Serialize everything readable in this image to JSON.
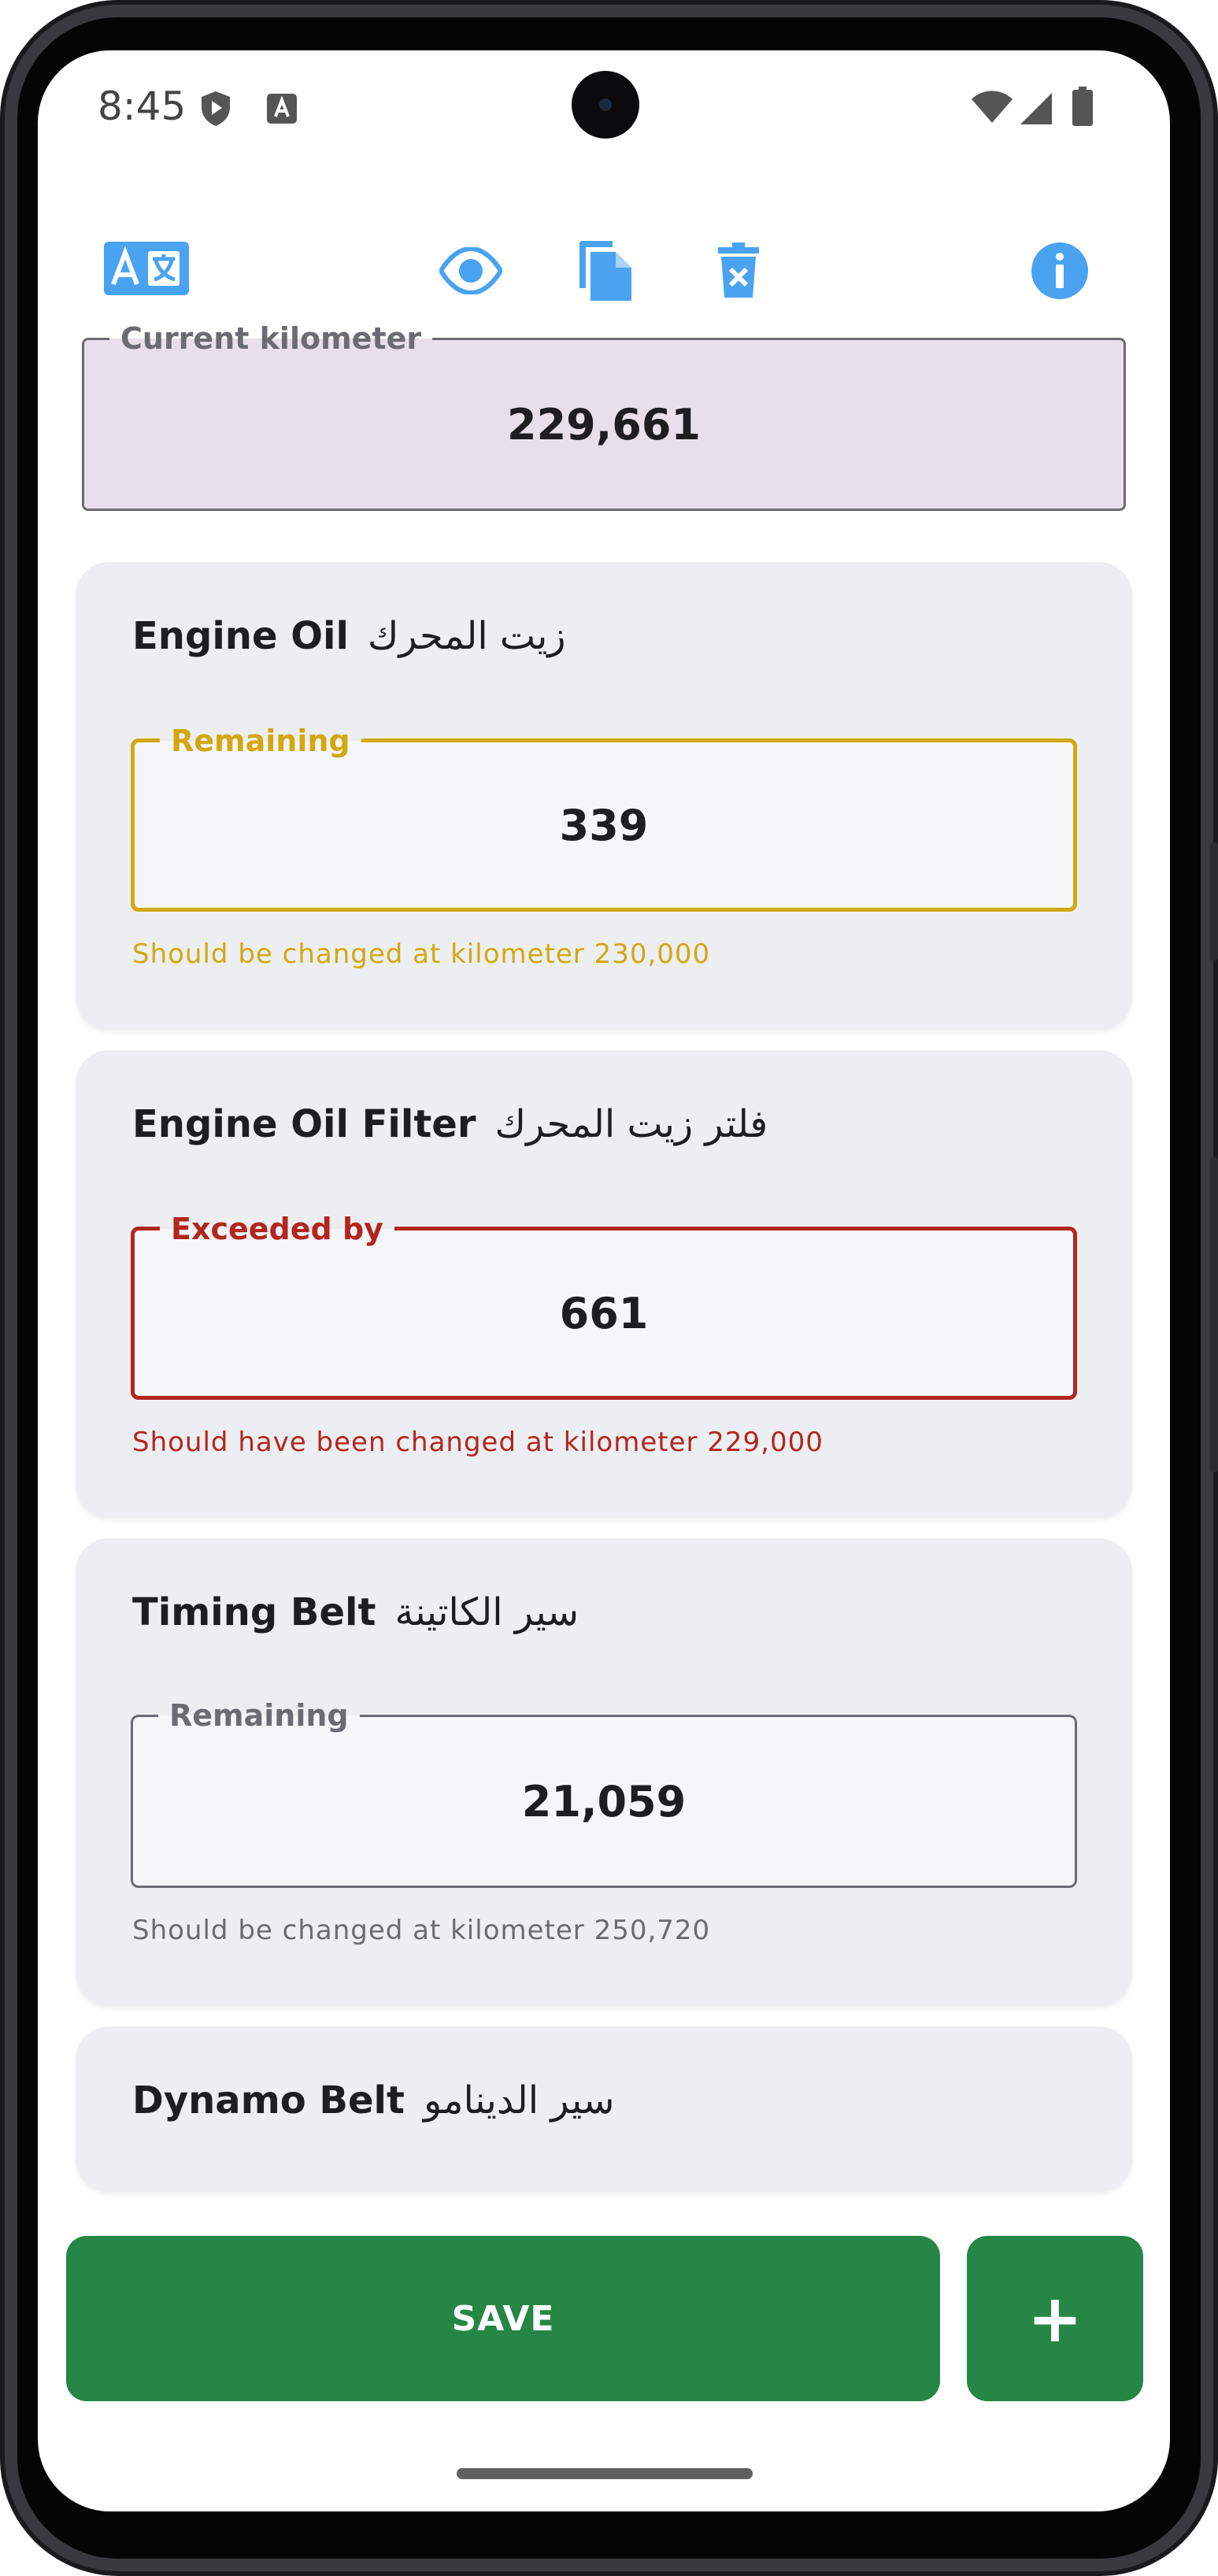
{
  "status_bar": {
    "time": "8:45"
  },
  "toolbar": {
    "icons": [
      "translate-icon",
      "eye-icon",
      "copy-icon",
      "delete-icon",
      "info-icon"
    ],
    "accent": "#4aa3f0"
  },
  "current_km": {
    "label": "Current kilometer",
    "value": "229,661"
  },
  "items": [
    {
      "title": "Engine Oil",
      "title_ar": "زيت المحرك",
      "field_label": "Remaining",
      "value": "339",
      "hint": "Should be changed at kilometer 230,000",
      "color": "#d2a80e"
    },
    {
      "title": "Engine Oil Filter",
      "title_ar": "فلتر زيت المحرك",
      "field_label": "Exceeded by",
      "value": "661",
      "hint": "Should have been changed at kilometer 229,000",
      "color": "#b3261e"
    },
    {
      "title": "Timing Belt",
      "title_ar": "سير الكاتينة",
      "field_label": "Remaining",
      "value": "21,059",
      "hint": "Should be changed at kilometer 250,720",
      "color": "#6b6b73"
    },
    {
      "title": "Dynamo Belt",
      "title_ar": "سير الدينامو"
    }
  ],
  "actions": {
    "save_label": "SAVE",
    "add_label": "+",
    "button_color": "#258646"
  }
}
